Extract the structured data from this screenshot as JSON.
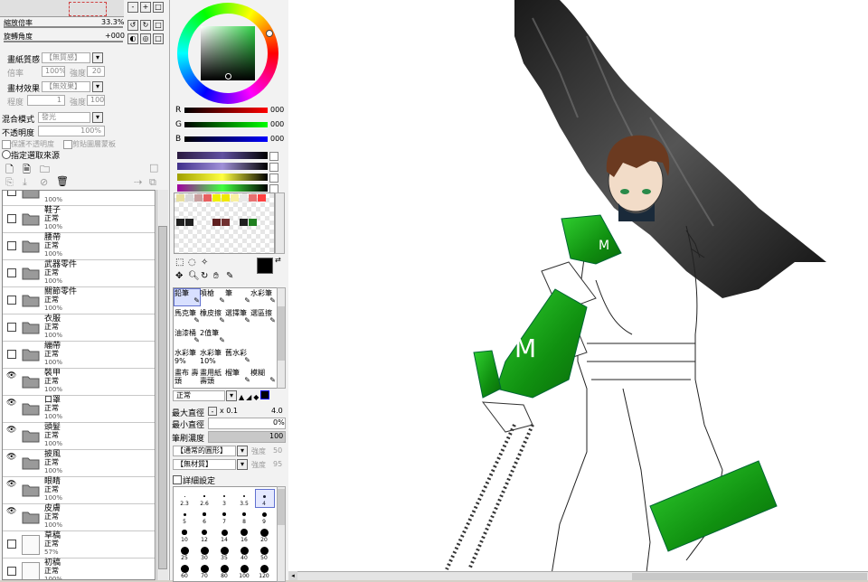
{
  "navigator": {
    "zoom_label": "縮放倍率",
    "zoom_value": "33.3%",
    "angle_label": "旋轉角度",
    "angle_value": "+000"
  },
  "paper": {
    "texture_label": "畫紙質感",
    "texture_value": "【無質感】",
    "scale_label": "倍率",
    "scale_value": "100%",
    "strength_label": "強度",
    "strength_value": "20",
    "effect_label": "畫材效果",
    "effect_value": "【無效果】",
    "degree_label": "程度",
    "degree_value": "1",
    "strength2_label": "強度",
    "strength2_value": "100"
  },
  "blend": {
    "mode_label": "混合模式",
    "mode_value": "發光",
    "opacity_label": "不透明度",
    "opacity_value": "100%",
    "protect_label": "保護不透明度",
    "clip_label": "剪貼圖層蒙板",
    "source_label": "指定選取來源"
  },
  "layers": [
    {
      "name": "",
      "mode": "",
      "opacity": "100%",
      "visible": false,
      "type": "folder"
    },
    {
      "name": "鞋子",
      "mode": "正常",
      "opacity": "100%",
      "visible": false,
      "type": "folder"
    },
    {
      "name": "腰帶",
      "mode": "正常",
      "opacity": "100%",
      "visible": false,
      "type": "folder"
    },
    {
      "name": "武器零件",
      "mode": "正常",
      "opacity": "100%",
      "visible": false,
      "type": "folder"
    },
    {
      "name": "關節零件",
      "mode": "正常",
      "opacity": "100%",
      "visible": false,
      "type": "folder"
    },
    {
      "name": "衣服",
      "mode": "正常",
      "opacity": "100%",
      "visible": false,
      "type": "folder"
    },
    {
      "name": "繃帶",
      "mode": "正常",
      "opacity": "100%",
      "visible": false,
      "type": "folder"
    },
    {
      "name": "裝甲",
      "mode": "正常",
      "opacity": "100%",
      "visible": true,
      "type": "folder"
    },
    {
      "name": "口罩",
      "mode": "正常",
      "opacity": "100%",
      "visible": true,
      "type": "folder"
    },
    {
      "name": "頭髮",
      "mode": "正常",
      "opacity": "100%",
      "visible": true,
      "type": "folder"
    },
    {
      "name": "披風",
      "mode": "正常",
      "opacity": "100%",
      "visible": true,
      "type": "folder"
    },
    {
      "name": "眼睛",
      "mode": "正常",
      "opacity": "100%",
      "visible": true,
      "type": "folder"
    },
    {
      "name": "皮膚",
      "mode": "正常",
      "opacity": "100%",
      "visible": true,
      "type": "folder"
    },
    {
      "name": "草稿",
      "mode": "正常",
      "opacity": "57%",
      "visible": false,
      "type": "image"
    },
    {
      "name": "初稿",
      "mode": "正常",
      "opacity": "100%",
      "visible": false,
      "type": "image"
    }
  ],
  "color": {
    "r_label": "R",
    "r_value": "000",
    "g_label": "G",
    "g_value": "000",
    "b_label": "B",
    "b_value": "000",
    "current": "#000000"
  },
  "swatches": [
    "#e8e0a0",
    "#d8d8d8",
    "#c8a0a0",
    "#e86060",
    "#f0f000",
    "#f0e800",
    "#f8f0a0",
    "#e8e8e8",
    "#e87070",
    "#ff4040",
    "#202020",
    "#202020",
    "#602020",
    "#703030",
    "#202020",
    "#208020"
  ],
  "tools": [
    {
      "label": "鉛筆",
      "selected": true
    },
    {
      "label": "噴槍",
      "selected": false
    },
    {
      "label": "筆",
      "selected": false
    },
    {
      "label": "水彩筆",
      "selected": false
    },
    {
      "label": "馬克筆",
      "selected": false
    },
    {
      "label": "橡皮擦",
      "selected": false
    },
    {
      "label": "選擇筆",
      "selected": false
    },
    {
      "label": "選區擦",
      "selected": false
    },
    {
      "label": "油漆桶",
      "selected": false
    },
    {
      "label": "2值筆",
      "selected": false
    },
    {
      "label": "",
      "selected": false
    },
    {
      "label": "",
      "selected": false
    },
    {
      "label": "水彩筆 9%",
      "selected": false
    },
    {
      "label": "水彩筆 10%",
      "selected": false
    },
    {
      "label": "舊水彩",
      "selected": false
    },
    {
      "label": "",
      "selected": false
    },
    {
      "label": "畫布 壽頭",
      "selected": false
    },
    {
      "label": "畫用紙 壽頭",
      "selected": false
    },
    {
      "label": "榴筆",
      "selected": false
    },
    {
      "label": "模糊",
      "selected": false
    }
  ],
  "brush": {
    "mode_value": "正常",
    "max_label": "最大直徑",
    "max_mult": "x 0.1",
    "max_value": "4.0",
    "min_label": "最小直徑",
    "min_value": "0%",
    "density_label": "筆刷濃度",
    "density_value": "100",
    "shape_value": "【通常的圓形】",
    "shape_strength_label": "強度",
    "shape_strength_value": "50",
    "texture_value": "【無材質】",
    "texture_strength_label": "強度",
    "texture_strength_value": "95",
    "detail_label": "詳細設定"
  },
  "dot_sizes": [
    "2.3",
    "2.6",
    "3",
    "3.5",
    "4",
    "5",
    "6",
    "7",
    "8",
    "9",
    "10",
    "12",
    "14",
    "16",
    "20",
    "25",
    "30",
    "35",
    "40",
    "50",
    "60",
    "70",
    "80",
    "100",
    "120"
  ]
}
